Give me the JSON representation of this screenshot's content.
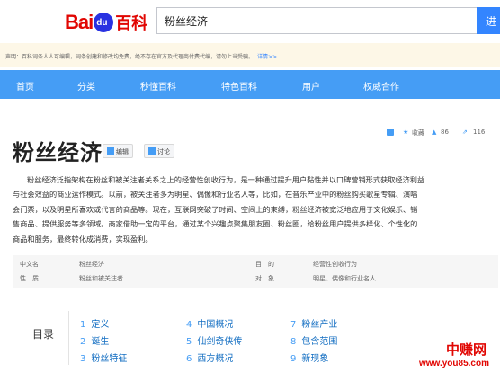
{
  "header": {
    "logo_part1": "Bai",
    "logo_paw": "du",
    "logo_part2": "百科",
    "search_value": "粉丝经济",
    "search_button": "进"
  },
  "notice": {
    "text": "声明：百科词条人人可编辑，词条创建和修改均免费，绝不存在官方及代理商付费代编，请勿上当受骗。",
    "link": "详情>>"
  },
  "nav": {
    "items": [
      "首页",
      "分类",
      "秒懂百科",
      "特色百科",
      "用户",
      "权威合作"
    ]
  },
  "toolbar": {
    "collect_label": "收藏",
    "like_count": "86",
    "share_count": "116"
  },
  "entry": {
    "title": "粉丝经济",
    "edit_label": "编辑",
    "discuss_label": "讨论",
    "paragraph_lines": [
      "粉丝经济泛指架构在粉丝和被关注者关系之上的经营性创收行为，是一种通过提升用户黏性并以口碑营销形式获取经济利益",
      "与社会效益的商业运作模式。以前，被关注者多为明星、偶像和行业名人等，比如，在音乐产业中的粉丝购买歌星专辑、演唱",
      "会门票，以及明星所喜欢或代言的商品等。现在，互联网突破了时间、空间上的束缚，粉丝经济被宽泛地应用于文化娱乐、销",
      "售商品、提供服务等多领域。商家借助一定的平台，通过某个兴趣点聚集朋友圈、粉丝圈，给粉丝用户提供多样化、个性化的",
      "商品和服务，最终转化成消费，实现盈利。"
    ]
  },
  "basic_info": {
    "rows": [
      {
        "k1": "中文名",
        "v1": "粉丝经济",
        "k2": "目　的",
        "v2": "经营性创收行为"
      },
      {
        "k1": "性　质",
        "v1": "粉丝和被关注者",
        "k2": "对　象",
        "v2": "明星、偶像和行业名人"
      }
    ]
  },
  "toc": {
    "label": "目录",
    "items": [
      {
        "num": "1",
        "text": "定义"
      },
      {
        "num": "2",
        "text": "诞生"
      },
      {
        "num": "3",
        "text": "粉丝特征"
      },
      {
        "num": "4",
        "text": "中国概况"
      },
      {
        "num": "5",
        "text": "仙剑奇侠传"
      },
      {
        "num": "6",
        "text": "西方概况"
      },
      {
        "num": "7",
        "text": "粉丝产业"
      },
      {
        "num": "8",
        "text": "包含范围"
      },
      {
        "num": "9",
        "text": "新现象"
      }
    ]
  },
  "watermark": {
    "line1": "中赚网",
    "line2": "www.you85.com"
  },
  "colors": {
    "brand_red": "#e10602",
    "brand_blue": "#2932e1",
    "nav_blue": "#459df5",
    "link_blue": "#136ec2"
  }
}
